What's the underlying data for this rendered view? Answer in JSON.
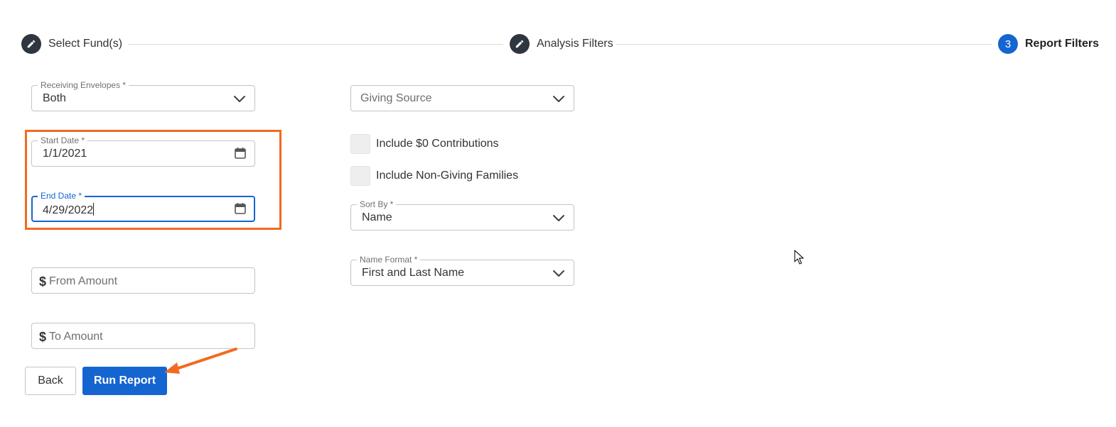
{
  "stepper": {
    "steps": [
      {
        "label": "Select Fund(s)",
        "icon": "pencil-icon",
        "state": "completed"
      },
      {
        "label": "Analysis Filters",
        "icon": "pencil-icon",
        "state": "completed"
      },
      {
        "label": "Report Filters",
        "number": "3",
        "state": "active"
      }
    ]
  },
  "left_column": {
    "receiving_envelopes": {
      "label": "Receiving Envelopes *",
      "value": "Both"
    },
    "start_date": {
      "label": "Start Date *",
      "value": "1/1/2021"
    },
    "end_date": {
      "label": "End Date *",
      "value": "4/29/2022"
    },
    "from_amount": {
      "currency_symbol": "$",
      "placeholder": "From Amount"
    },
    "to_amount": {
      "currency_symbol": "$",
      "placeholder": "To Amount"
    }
  },
  "right_column": {
    "giving_source": {
      "placeholder": "Giving Source"
    },
    "include_zero_contributions": {
      "label": "Include $0 Contributions",
      "checked": false
    },
    "include_non_giving_families": {
      "label": "Include Non-Giving Families",
      "checked": false
    },
    "sort_by": {
      "label": "Sort By *",
      "value": "Name"
    },
    "name_format": {
      "label": "Name Format *",
      "value": "First and Last Name"
    }
  },
  "actions": {
    "back_label": "Back",
    "run_report_label": "Run Report"
  },
  "colors": {
    "primary": "#1565d0",
    "step_dark": "#2f3640",
    "annotation": "#f26a21"
  }
}
